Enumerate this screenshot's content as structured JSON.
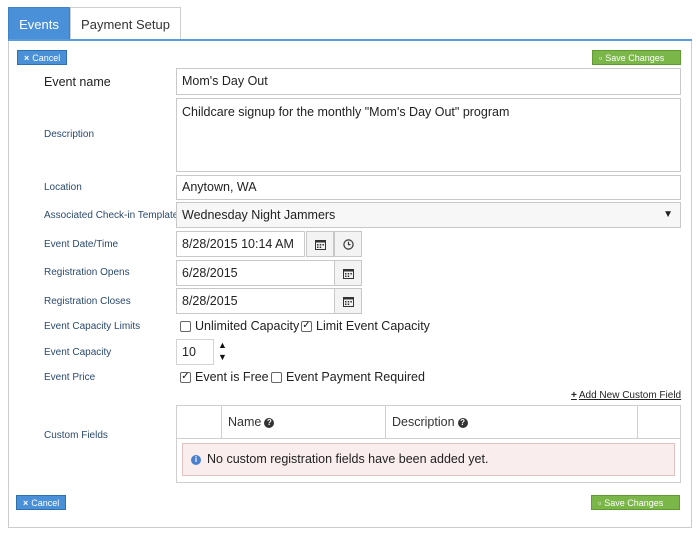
{
  "tabs": [
    {
      "label": "Events"
    },
    {
      "label": "Payment Setup"
    }
  ],
  "toolbar": {
    "cancel_label": "Cancel",
    "save_label": "Save Changes"
  },
  "form": {
    "event_name": {
      "label": "Event name",
      "value": "Mom's Day Out"
    },
    "description": {
      "label": "Description",
      "value": "Childcare signup for the monthly \"Mom's Day Out\" program"
    },
    "location": {
      "label": "Location",
      "value": "Anytown, WA"
    },
    "template": {
      "label": "Associated Check-in Template",
      "value": "Wednesday Night Jammers"
    },
    "event_date": {
      "label": "Event Date/Time",
      "value": "8/28/2015 10:14 AM"
    },
    "reg_opens": {
      "label": "Registration Opens",
      "value": "6/28/2015"
    },
    "reg_closes": {
      "label": "Registration Closes",
      "value": "8/28/2015"
    },
    "capacity_limits": {
      "label": "Event Capacity Limits",
      "unlimited": "Unlimited Capacity",
      "limit": "Limit Event Capacity"
    },
    "capacity": {
      "label": "Event Capacity",
      "value": "10"
    },
    "price": {
      "label": "Event Price",
      "free": "Event is Free",
      "payment": "Event Payment Required"
    },
    "custom_fields": {
      "label": "Custom Fields",
      "add_link": "Add New Custom Field",
      "columns": [
        "Name",
        "Description"
      ],
      "empty_message": "No custom registration fields have been added yet."
    }
  },
  "states": {
    "unlimited_checked": false,
    "limit_checked": true,
    "free_checked": true,
    "payment_checked": false
  },
  "colors": {
    "primary": "#4a90d9",
    "save": "#7ab648",
    "notice_bg": "#f9eded"
  }
}
